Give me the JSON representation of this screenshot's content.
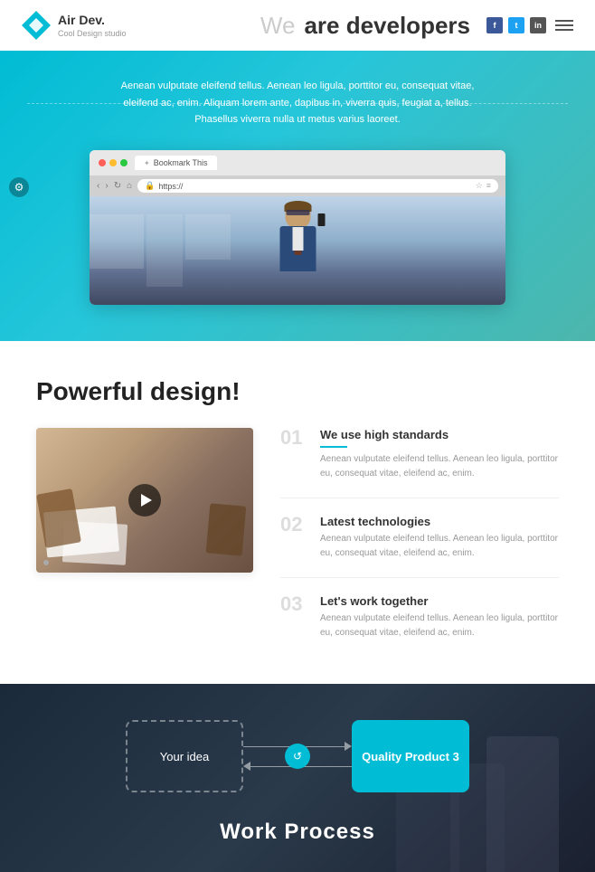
{
  "header": {
    "logo_name": "Air Dev.",
    "logo_sub": "Cool Design studio",
    "title_we": "We ",
    "title_bold": "are developers",
    "social_icons": [
      "f",
      "t",
      "in"
    ],
    "hero_text": "Aenean vulputate eleifend tellus. Aenean leo ligula, porttitor eu, consequat vitae, eleifend ac, enim. Aliquam lorem ante, dapibus in, viverra quis, feugiat a, tellus. Phasellus viverra nulla ut metus varius laoreet."
  },
  "browser": {
    "tab_label": "Bookmark This",
    "url": "https://"
  },
  "design_section": {
    "title": "Powerful design!",
    "features": [
      {
        "num": "01",
        "title": "We use high standards",
        "desc": "Aenean vulputate eleifend tellus. Aenean leo ligula, porttitor eu, consequat vitae, eleifend ac, enim."
      },
      {
        "num": "02",
        "title": "Latest technologies",
        "desc": "Aenean vulputate eleifend tellus. Aenean leo ligula, porttitor eu, consequat vitae, eleifend ac, enim."
      },
      {
        "num": "03",
        "title": "Let's work together",
        "desc": "Aenean vulputate eleifend tellus. Aenean leo ligula, porttitor eu, consequat vitae, eleifend ac, enim."
      }
    ]
  },
  "process_section": {
    "box1_label": "Your idea",
    "box2_label": "Quality Product 3",
    "title": "Work Process"
  }
}
